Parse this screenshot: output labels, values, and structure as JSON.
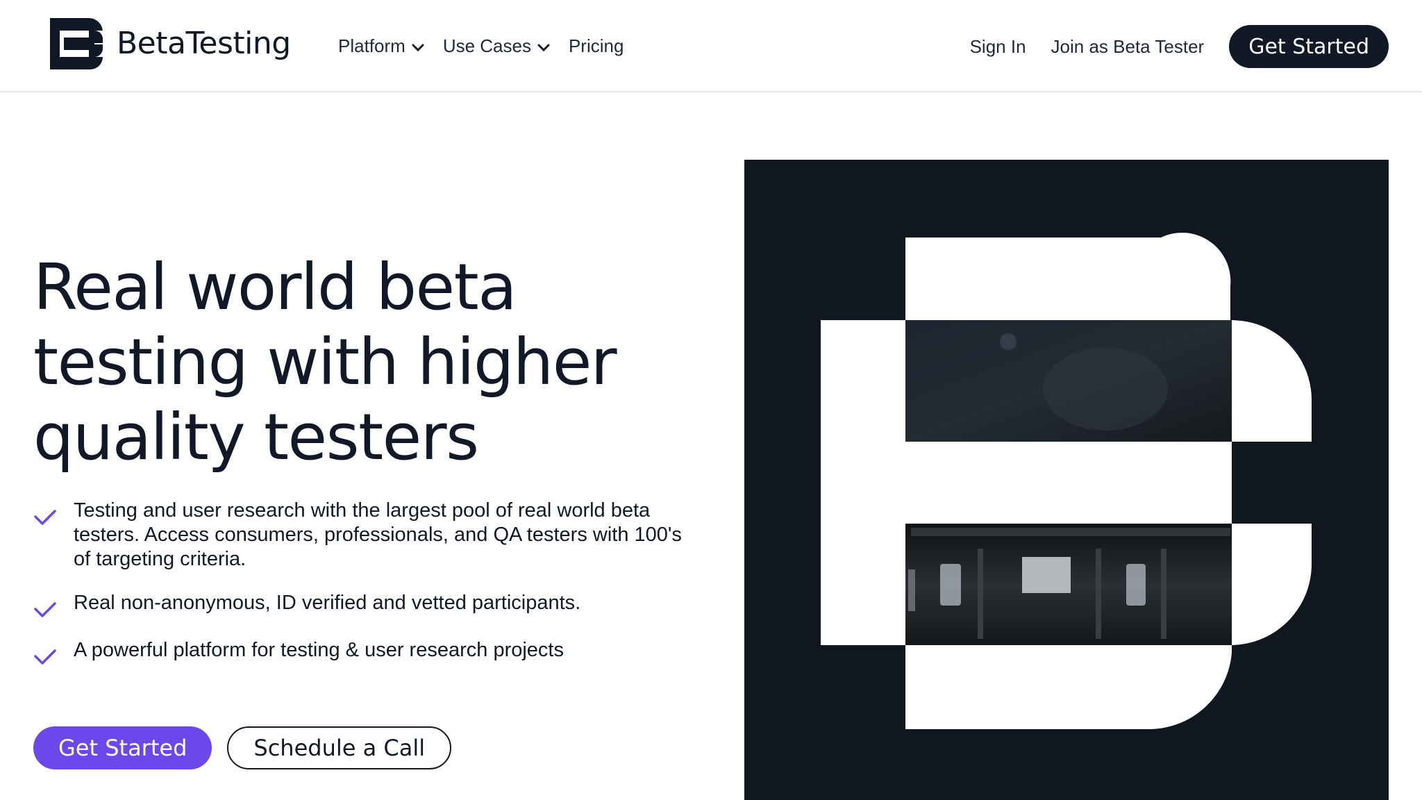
{
  "brand": {
    "name": "BetaTesting",
    "logo_icon": "betatesting-b-logo-icon"
  },
  "nav": {
    "items": [
      {
        "label": "Platform",
        "has_dropdown": true
      },
      {
        "label": "Use Cases",
        "has_dropdown": true
      },
      {
        "label": "Pricing",
        "has_dropdown": false
      }
    ]
  },
  "header_actions": {
    "sign_in": "Sign In",
    "join_tester": "Join as Beta Tester",
    "get_started": "Get Started"
  },
  "hero": {
    "title": "Real world beta testing with higher quality testers",
    "features": [
      "Testing and user research with the largest pool of real world beta testers. Access consumers, professionals, and QA testers with 100's of targeting criteria.",
      "Real non-anonymous, ID verified and vetted participants.",
      "A powerful platform for testing & user research projects"
    ],
    "primary_cta": "Get Started",
    "secondary_cta": "Schedule a Call",
    "image": "large-b-logo-photo-collage"
  },
  "colors": {
    "dark": "#111827",
    "accent_purple": "#6c47ea",
    "graphic_bg": "#111720",
    "check": "#6c47ea"
  }
}
